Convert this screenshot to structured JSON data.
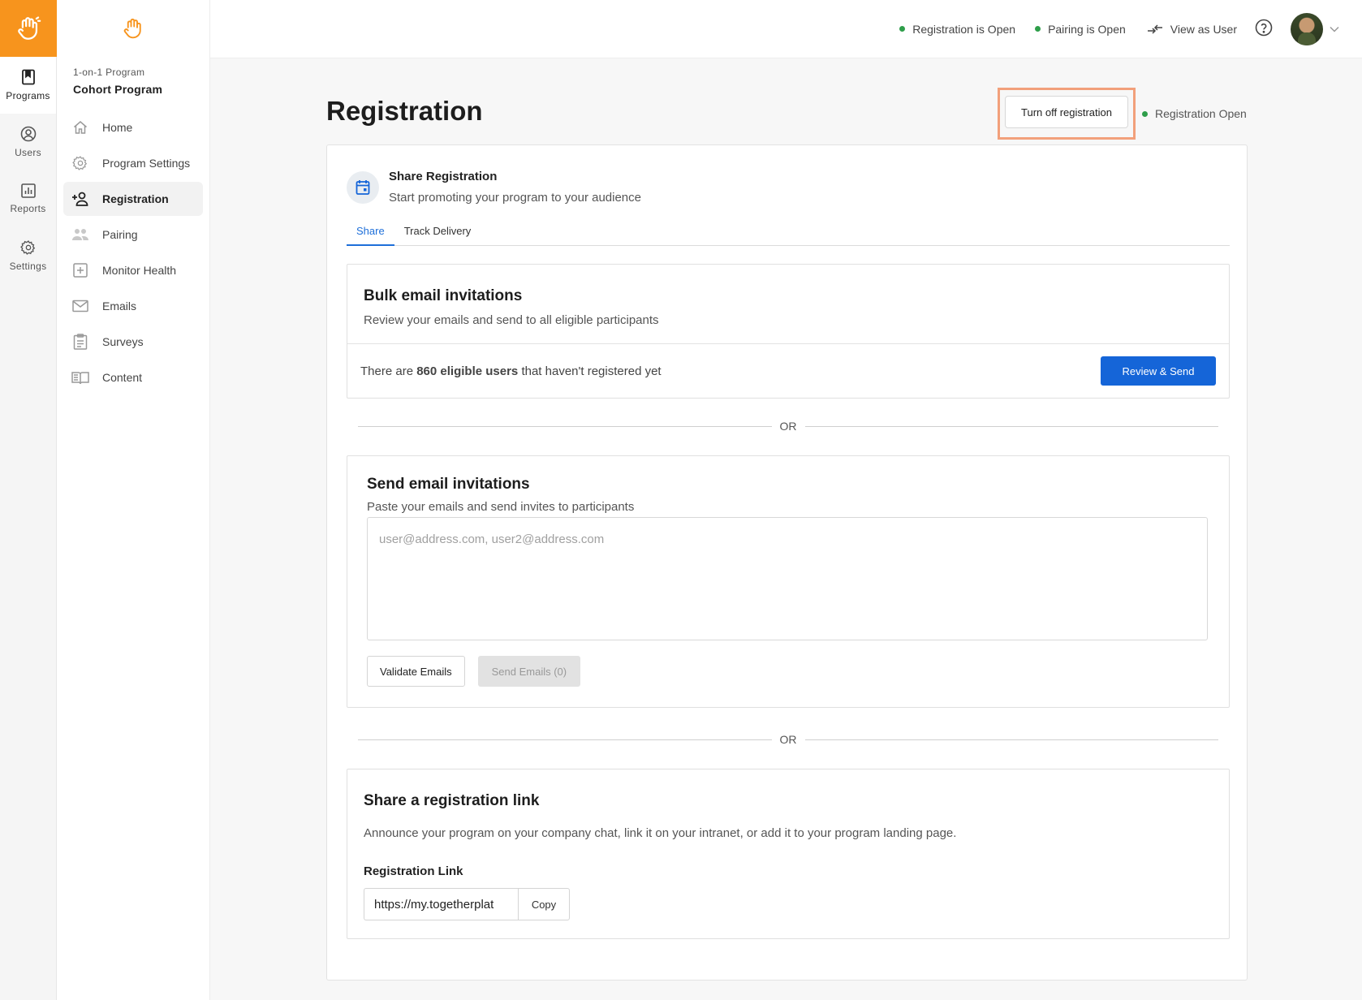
{
  "rail": {
    "items": [
      {
        "label": "Programs",
        "icon": "book-icon"
      },
      {
        "label": "Users",
        "icon": "user-circle-icon"
      },
      {
        "label": "Reports",
        "icon": "bar-chart-icon"
      },
      {
        "label": "Settings",
        "icon": "gear-icon"
      }
    ]
  },
  "sidebar": {
    "program_type": "1-on-1 Program",
    "program_name": "Cohort Program",
    "items": [
      {
        "label": "Home",
        "icon": "home-icon"
      },
      {
        "label": "Program Settings",
        "icon": "gear-icon"
      },
      {
        "label": "Registration",
        "icon": "add-person-icon"
      },
      {
        "label": "Pairing",
        "icon": "people-icon"
      },
      {
        "label": "Monitor Health",
        "icon": "plus-square-icon"
      },
      {
        "label": "Emails",
        "icon": "envelope-icon"
      },
      {
        "label": "Surveys",
        "icon": "clipboard-icon"
      },
      {
        "label": "Content",
        "icon": "book-open-icon"
      }
    ]
  },
  "topbar": {
    "registration_status": "Registration is Open",
    "pairing_status": "Pairing is Open",
    "view_as_user": "View as User"
  },
  "colors": {
    "brand": "#f7941d",
    "primary": "#1565d8",
    "status_open": "#2e9e4a",
    "highlight": "#f2a07b"
  },
  "page": {
    "title": "Registration",
    "turn_off_label": "Turn off registration",
    "status_label": "Registration Open"
  },
  "share": {
    "title": "Share Registration",
    "subtitle": "Start promoting your program to your audience",
    "tabs": [
      "Share",
      "Track Delivery"
    ]
  },
  "bulk": {
    "title": "Bulk email invitations",
    "subtitle": "Review your emails and send to all eligible participants",
    "text_before": "There are ",
    "count_text": "860 eligible users",
    "text_after": " that haven't registered yet",
    "button": "Review & Send"
  },
  "or_label": "OR",
  "send": {
    "title": "Send email invitations",
    "subtitle": "Paste your emails and send invites to participants",
    "placeholder": "user@address.com, user2@address.com",
    "validate_label": "Validate Emails",
    "send_label": "Send Emails (0)"
  },
  "link": {
    "title": "Share a registration link",
    "subtitle": "Announce your program on your company chat, link it on your intranet, or add it to your program landing page.",
    "label": "Registration Link",
    "value": "https://my.togetherplat",
    "copy_label": "Copy"
  }
}
